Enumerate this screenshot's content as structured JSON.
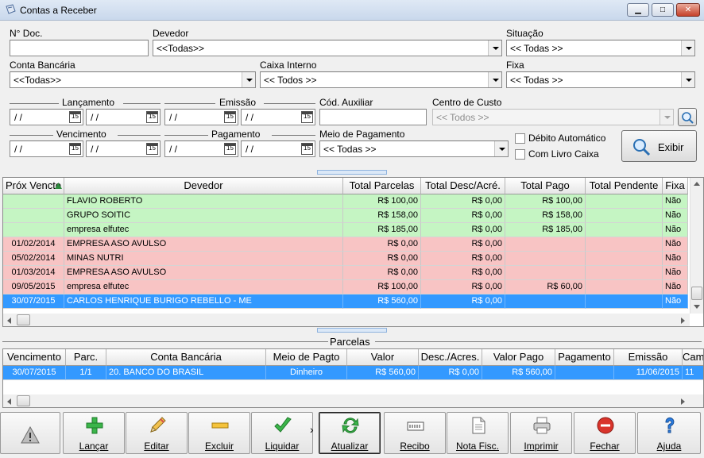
{
  "window": {
    "title": "Contas a Receber"
  },
  "filters": {
    "ndoc_label": "N° Doc.",
    "ndoc_value": "",
    "devedor_label": "Devedor",
    "devedor_value": "<<Todas>>",
    "situacao_label": "Situação",
    "situacao_value": "<< Todas >>",
    "conta_label": "Conta Bancária",
    "conta_value": "<<Todas>>",
    "caixa_label": "Caixa Interno",
    "caixa_value": "<< Todos >>",
    "fixa_label": "Fixa",
    "fixa_value": "<< Todas >>",
    "lancamento_label": "Lançamento",
    "emissao_label": "Emissão",
    "vencimento_label": "Vencimento",
    "pagamento_label": "Pagamento",
    "date_placeholder": "/ /",
    "calendar_glyph": "15",
    "cod_aux_label": "Cód. Auxiliar",
    "cod_aux_value": "",
    "centro_label": "Centro de Custo",
    "centro_value": "<< Todos >>",
    "meio_label": "Meio de Pagamento",
    "meio_value": "<< Todas >>",
    "debito_label": "Débito Automático",
    "livro_label": "Com Livro Caixa",
    "exibir_label": "Exibir"
  },
  "main_grid": {
    "columns": [
      "Próx Vencto",
      "Devedor",
      "Total Parcelas",
      "Total Desc/Acré.",
      "Total Pago",
      "Total Pendente",
      "Fixa"
    ],
    "rows": [
      {
        "venc": "",
        "devedor": "FLAVIO ROBERTO",
        "parcelas": "R$ 100,00",
        "desc": "R$ 0,00",
        "pago": "R$ 100,00",
        "pendente": "",
        "fixa": "Não",
        "status": "green"
      },
      {
        "venc": "",
        "devedor": "GRUPO SOITIC",
        "parcelas": "R$ 158,00",
        "desc": "R$ 0,00",
        "pago": "R$ 158,00",
        "pendente": "",
        "fixa": "Não",
        "status": "green"
      },
      {
        "venc": "",
        "devedor": "empresa elfutec",
        "parcelas": "R$ 185,00",
        "desc": "R$ 0,00",
        "pago": "R$ 185,00",
        "pendente": "",
        "fixa": "Não",
        "status": "green"
      },
      {
        "venc": "01/02/2014",
        "devedor": "EMPRESA ASO AVULSO",
        "parcelas": "R$ 0,00",
        "desc": "R$ 0,00",
        "pago": "",
        "pendente": "",
        "fixa": "Não",
        "status": "red"
      },
      {
        "venc": "05/02/2014",
        "devedor": "MINAS NUTRI",
        "parcelas": "R$ 0,00",
        "desc": "R$ 0,00",
        "pago": "",
        "pendente": "",
        "fixa": "Não",
        "status": "red"
      },
      {
        "venc": "01/03/2014",
        "devedor": "EMPRESA ASO AVULSO",
        "parcelas": "R$ 0,00",
        "desc": "R$ 0,00",
        "pago": "",
        "pendente": "",
        "fixa": "Não",
        "status": "red"
      },
      {
        "venc": "09/05/2015",
        "devedor": "empresa elfutec",
        "parcelas": "R$ 100,00",
        "desc": "R$ 0,00",
        "pago": "R$ 60,00",
        "pendente": "",
        "fixa": "Não",
        "status": "red"
      },
      {
        "venc": "30/07/2015",
        "devedor": "CARLOS HENRIQUE BURIGO REBELLO - ME",
        "parcelas": "R$ 560,00",
        "desc": "R$ 0,00",
        "pago": "",
        "pendente": "",
        "fixa": "Não",
        "status": "sel"
      }
    ]
  },
  "parcelas": {
    "title": "Parcelas",
    "columns": [
      "Vencimento",
      "Parc.",
      "Conta Bancária",
      "Meio de Pagto",
      "Valor",
      "Desc./Acres.",
      "Valor Pago",
      "Pagamento",
      "Emissão",
      "Cam"
    ],
    "rows": [
      {
        "venc": "30/07/2015",
        "parc": "1/1",
        "conta": "20. BANCO DO BRASIL",
        "meio": "Dinheiro",
        "valor": "R$ 560,00",
        "desc": "R$ 0,00",
        "pago": "R$ 560,00",
        "pagamento": "",
        "emissao": "11/06/2015",
        "cam": "11"
      }
    ]
  },
  "toolbar": {
    "lancar": "Lançar",
    "editar": "Editar",
    "excluir": "Excluir",
    "liquidar": "Liquidar",
    "more": "›",
    "atualizar": "Atualizar",
    "recibo": "Recibo",
    "nota": "Nota Fisc.",
    "imprimir": "Imprimir",
    "fechar": "Fechar",
    "ajuda": "Ajuda"
  },
  "colors": {
    "paid_row": "#c5f5c3",
    "overdue_row": "#f8c4c4",
    "selected_row": "#3399ff"
  }
}
